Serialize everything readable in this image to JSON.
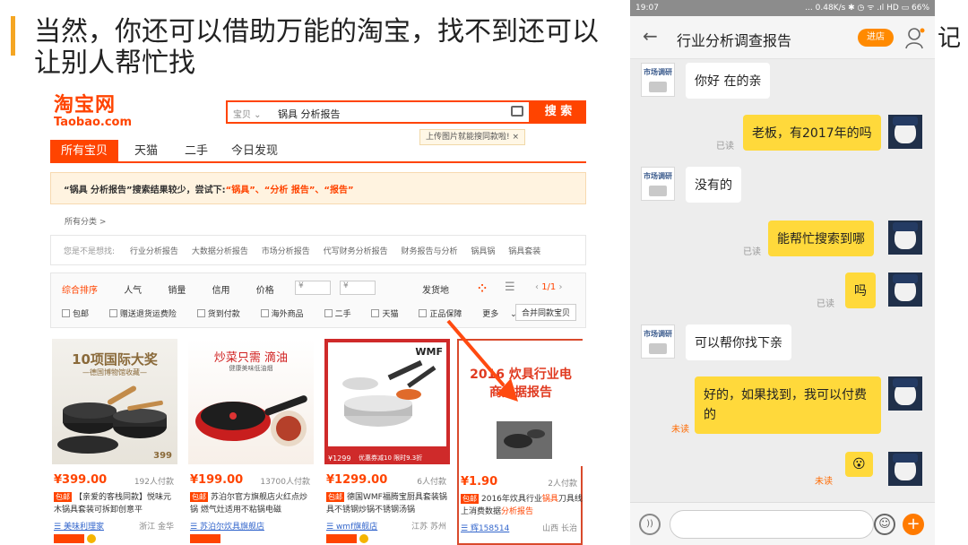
{
  "slide": {
    "title": "当然，你还可以借助万能的淘宝，找不到还可以让别人帮忙找",
    "right_char": "记"
  },
  "taobao": {
    "logo_cn": "淘宝网",
    "logo_en": "Taobao.com",
    "search_scope": "宝贝",
    "search_query": "锅具 分析报告",
    "search_button": "搜 索",
    "upload_tip": "上传图片就能搜同款啦! ×",
    "nav_tabs": [
      "所有宝贝",
      "天猫",
      "二手",
      "今日发现"
    ],
    "notice_prefix": "“锅具 分析报告”搜索结果较少，尝试下:",
    "notice_keywords": "“锅具”、“分析 报告”、“报告”",
    "all_categories": "所有分类 >",
    "maybe_label": "您是不是想找:",
    "maybe_items": [
      "行业分析报告",
      "大数据分析报告",
      "市场分析报告",
      "代写财务分析报告",
      "财务报告与分析",
      "锅具锅",
      "锅具套装"
    ],
    "sort_items": [
      "综合排序",
      "人气",
      "销量",
      "信用",
      "价格"
    ],
    "price_from": "¥",
    "price_to": "¥",
    "ship_from": "发货地",
    "pager": "1/1",
    "filters": [
      "包邮",
      "赠送退货运费险",
      "货到付款",
      "海外商品",
      "二手",
      "天猫",
      "正品保障"
    ],
    "more": "更多",
    "merge": "合并同款宝贝",
    "products": [
      {
        "img_title": "10项国际大奖",
        "img_sub": "—德国博物馆收藏—",
        "img_price": "399",
        "price": "¥399.00",
        "paid": "192人付款",
        "tag": "包邮",
        "desc": "【亲爱的客栈同款】悦味元木锅具套装可拆卸创意平",
        "shop": "美味利理家",
        "loc": "浙江 金华"
      },
      {
        "img_title": "炒菜只需 滴油",
        "img_sub": "健康美味低油烟",
        "price": "¥199.00",
        "paid": "13700人付款",
        "tag": "包邮",
        "desc": "苏泊尔官方旗舰店火红点炒锅 燃气灶适用不粘锅电磁",
        "shop": "苏泊尔炊具旗舰店",
        "loc": ""
      },
      {
        "img_brand": "WMF",
        "img_price": "¥1299",
        "img_sub": "优惠券减10  限时9.3折",
        "price": "¥1299.00",
        "paid": "6人付款",
        "tag": "包邮",
        "desc": "德国WMF福腾宝厨具套装锅具不锈钢炒锅不锈钢汤锅",
        "shop": "wmf旗舰店",
        "loc": "江苏 苏州"
      },
      {
        "img_title": "2016 炊具行业电商数据报告",
        "price": "¥1.90",
        "paid": "2人付款",
        "tag": "包邮",
        "desc_a": "2016年炊具行业",
        "desc_kw1": "锅具",
        "desc_b": "刀具线上消费数据",
        "desc_kw2": "分析报告",
        "shop": "辉158514",
        "loc": "山西 长治"
      }
    ]
  },
  "phone": {
    "time": "19:07",
    "status_right": "... 0.48K/s ✱ ◷ ᯤ .ıl HD ▭ 66%",
    "back": "←",
    "title": "行业分析调查报告",
    "shop_button": "进店",
    "shop_avatar_text": "市场调研",
    "messages": [
      {
        "side": "left",
        "text": "你好 在的亲"
      },
      {
        "side": "right",
        "text": "老板，有2017年的吗",
        "status": "已读"
      },
      {
        "side": "left",
        "text": "没有的"
      },
      {
        "side": "right",
        "text": "能帮忙搜索到哪",
        "status": "已读"
      },
      {
        "side": "right",
        "text": "吗",
        "status": "已读"
      },
      {
        "side": "left",
        "text": "可以帮你找下亲"
      },
      {
        "side": "right",
        "text": "好的，如果找到，我可以付费的",
        "status": "未读"
      },
      {
        "side": "right",
        "text": "😮",
        "status": "未读"
      }
    ],
    "voice_icon": "))",
    "emoji_icon": "☺",
    "plus_icon": "+"
  },
  "colors": {
    "taobao_orange": "#ff4400",
    "bubble_yellow": "#ffd93b",
    "accent_bar": "#f5a623"
  }
}
